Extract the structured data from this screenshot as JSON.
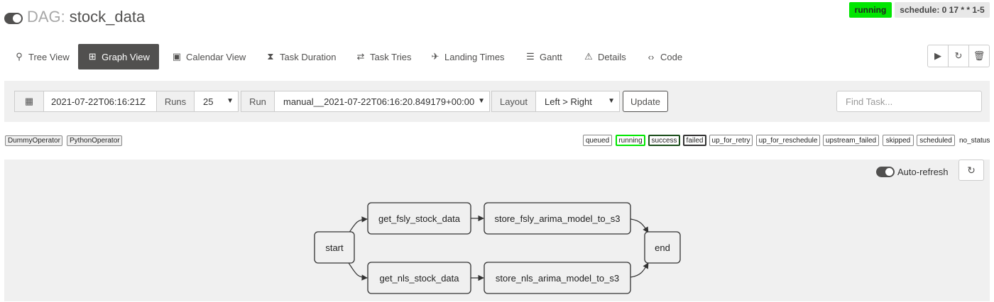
{
  "header": {
    "dag_prefix": "DAG:",
    "dag_id": "stock_data",
    "state": "running",
    "schedule": "schedule: 0 17 * * 1-5"
  },
  "nav": [
    {
      "label": "Tree View",
      "icon": "tree-icon",
      "glyph": "⚲"
    },
    {
      "label": "Graph View",
      "icon": "graph-icon",
      "glyph": "⊞"
    },
    {
      "label": "Calendar View",
      "icon": "calendar-icon",
      "glyph": "▣"
    },
    {
      "label": "Task Duration",
      "icon": "hourglass-icon",
      "glyph": "⧗"
    },
    {
      "label": "Task Tries",
      "icon": "retry-icon",
      "glyph": "⇄"
    },
    {
      "label": "Landing Times",
      "icon": "plane-icon",
      "glyph": "✈"
    },
    {
      "label": "Gantt",
      "icon": "gantt-icon",
      "glyph": "☰"
    },
    {
      "label": "Details",
      "icon": "warning-icon",
      "glyph": "⚠"
    },
    {
      "label": "Code",
      "icon": "code-icon",
      "glyph": "‹›"
    }
  ],
  "actions": {
    "trigger": "▶",
    "refresh": "↻",
    "delete": "🗑"
  },
  "filter": {
    "calendar_glyph": "▦",
    "base_date": "2021-07-22T06:16:21Z",
    "runs_label": "Runs",
    "runs_value": "25",
    "run_label": "Run",
    "run_value": "manual__2021-07-22T06:16:20.849179+00:00",
    "layout_label": "Layout",
    "layout_value": "Left > Right",
    "update_label": "Update",
    "find_placeholder": "Find Task..."
  },
  "operators": [
    "DummyOperator",
    "PythonOperator"
  ],
  "legend": {
    "states": [
      "queued",
      "running",
      "success",
      "failed",
      "up_for_retry",
      "up_for_reschedule",
      "upstream_failed",
      "skipped",
      "scheduled"
    ],
    "no_status": "no_status",
    "colors": {
      "queued": "#808080",
      "running": "#00e600",
      "success": "#008000",
      "failed": "#ff0000",
      "up_for_retry": "#ffd700",
      "up_for_reschedule": "#40e0d0",
      "upstream_failed": "#ffa500",
      "skipped": "#ff69b4",
      "scheduled": "#d2b48c"
    }
  },
  "graph": {
    "autorefresh_label": "Auto-refresh",
    "nodes": [
      "start",
      "get_fsly_stock_data",
      "store_fsly_arima_model_to_s3",
      "get_nls_stock_data",
      "store_nls_arima_model_to_s3",
      "end"
    ]
  }
}
